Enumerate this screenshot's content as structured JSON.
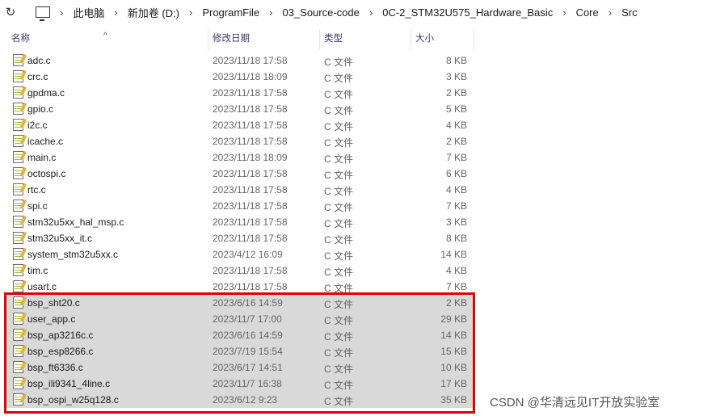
{
  "breadcrumbs": [
    "此电脑",
    "新加卷 (D:)",
    "ProgramFile",
    "03_Source-code",
    "0C-2_STM32U575_Hardware_Basic",
    "Core",
    "Src"
  ],
  "columns": {
    "name": "名称",
    "date": "修改日期",
    "type": "类型",
    "size": "大小"
  },
  "files": [
    {
      "name": "adc.c",
      "date": "2023/11/18 17:58",
      "type": "C 文件",
      "size": "8 KB"
    },
    {
      "name": "crc.c",
      "date": "2023/11/18 18:09",
      "type": "C 文件",
      "size": "3 KB"
    },
    {
      "name": "gpdma.c",
      "date": "2023/11/18 17:58",
      "type": "C 文件",
      "size": "2 KB"
    },
    {
      "name": "gpio.c",
      "date": "2023/11/18 17:58",
      "type": "C 文件",
      "size": "5 KB"
    },
    {
      "name": "i2c.c",
      "date": "2023/11/18 17:58",
      "type": "C 文件",
      "size": "4 KB"
    },
    {
      "name": "icache.c",
      "date": "2023/11/18 17:58",
      "type": "C 文件",
      "size": "2 KB"
    },
    {
      "name": "main.c",
      "date": "2023/11/18 18:09",
      "type": "C 文件",
      "size": "7 KB"
    },
    {
      "name": "octospi.c",
      "date": "2023/11/18 17:58",
      "type": "C 文件",
      "size": "6 KB"
    },
    {
      "name": "rtc.c",
      "date": "2023/11/18 17:58",
      "type": "C 文件",
      "size": "4 KB"
    },
    {
      "name": "spi.c",
      "date": "2023/11/18 17:58",
      "type": "C 文件",
      "size": "7 KB"
    },
    {
      "name": "stm32u5xx_hal_msp.c",
      "date": "2023/11/18 17:58",
      "type": "C 文件",
      "size": "3 KB"
    },
    {
      "name": "stm32u5xx_it.c",
      "date": "2023/11/18 17:58",
      "type": "C 文件",
      "size": "8 KB"
    },
    {
      "name": "system_stm32u5xx.c",
      "date": "2023/4/12 16:09",
      "type": "C 文件",
      "size": "14 KB"
    },
    {
      "name": "tim.c",
      "date": "2023/11/18 17:58",
      "type": "C 文件",
      "size": "4 KB"
    },
    {
      "name": "usart.c",
      "date": "2023/11/18 17:58",
      "type": "C 文件",
      "size": "7 KB"
    },
    {
      "name": "bsp_sht20.c",
      "date": "2023/6/16 14:59",
      "type": "C 文件",
      "size": "2 KB",
      "selected": true
    },
    {
      "name": "user_app.c",
      "date": "2023/11/7 17:00",
      "type": "C 文件",
      "size": "29 KB",
      "selected": true
    },
    {
      "name": "bsp_ap3216c.c",
      "date": "2023/6/16 14:59",
      "type": "C 文件",
      "size": "14 KB",
      "selected": true
    },
    {
      "name": "bsp_esp8266.c",
      "date": "2023/7/19 15:54",
      "type": "C 文件",
      "size": "15 KB",
      "selected": true
    },
    {
      "name": "bsp_ft6336.c",
      "date": "2023/6/17 14:51",
      "type": "C 文件",
      "size": "10 KB",
      "selected": true
    },
    {
      "name": "bsp_ili9341_4line.c",
      "date": "2023/11/7 16:38",
      "type": "C 文件",
      "size": "17 KB",
      "selected": true
    },
    {
      "name": "bsp_ospi_w25q128.c",
      "date": "2023/6/12 9:23",
      "type": "C 文件",
      "size": "35 KB",
      "selected": true
    }
  ],
  "watermark": "CSDN @华清远见IT开放实验室",
  "colors": {
    "highlight_border": "#e00000",
    "selected_row": "#d9d9d9"
  },
  "icons": {
    "refresh": "refresh-icon",
    "computer": "monitor-icon",
    "file": "c-file-icon",
    "sort": "sort-up-arrow-icon"
  }
}
